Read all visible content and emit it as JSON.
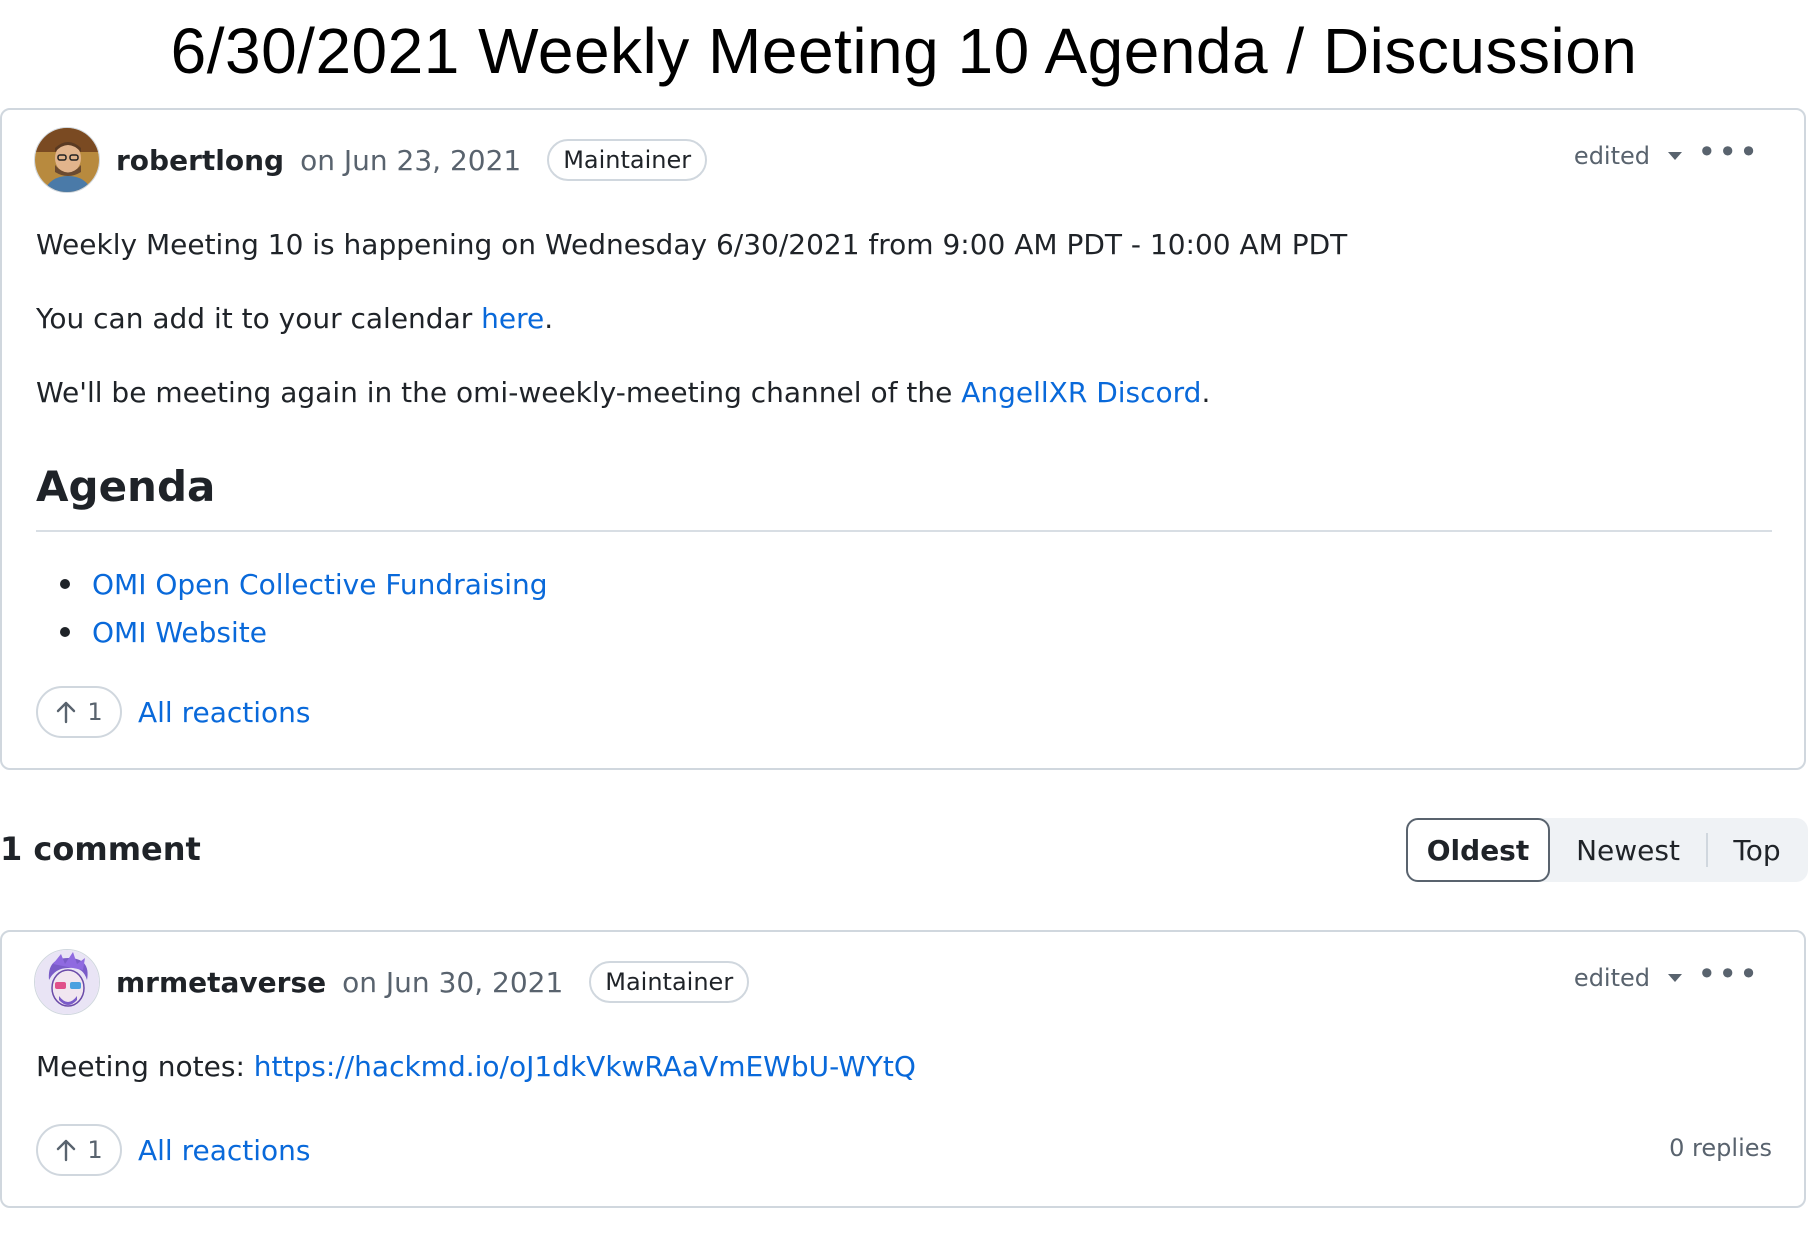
{
  "page_title": "6/30/2021 Weekly Meeting 10 Agenda / Discussion",
  "post": {
    "author": "robertlong",
    "date": "on Jun 23, 2021",
    "badge": "Maintainer",
    "edited_label": "edited",
    "menu_label": "•••",
    "line1": "Weekly Meeting 10 is happening on Wednesday 6/30/2021 from 9:00 AM PDT - 10:00 AM PDT",
    "line2_prefix": "You can add it to your calendar ",
    "line2_link": "here",
    "line2_suffix": ".",
    "line3_prefix": "We'll be meeting again in the omi-weekly-meeting channel of the ",
    "line3_link": "AngellXR Discord",
    "line3_suffix": ".",
    "agenda_heading": "Agenda",
    "agenda_items": [
      {
        "label": "OMI Open Collective Fundraising"
      },
      {
        "label": "OMI Website"
      }
    ],
    "upvotes": "1",
    "all_reactions": "All reactions"
  },
  "comments_header": {
    "count_label": "1 comment",
    "sort_options": [
      "Oldest",
      "Newest",
      "Top"
    ],
    "selected": "Oldest"
  },
  "comment": {
    "author": "mrmetaverse",
    "date": "on Jun 30, 2021",
    "badge": "Maintainer",
    "edited_label": "edited",
    "menu_label": "•••",
    "notes_prefix": "Meeting notes: ",
    "notes_link": "https://hackmd.io/oJ1dkVkwRAaVmEWbU-WYtQ",
    "upvotes": "1",
    "all_reactions": "All reactions",
    "replies": "0 replies"
  },
  "colors": {
    "link": "#0969da",
    "border": "#d0d7de",
    "muted": "#59636e"
  }
}
